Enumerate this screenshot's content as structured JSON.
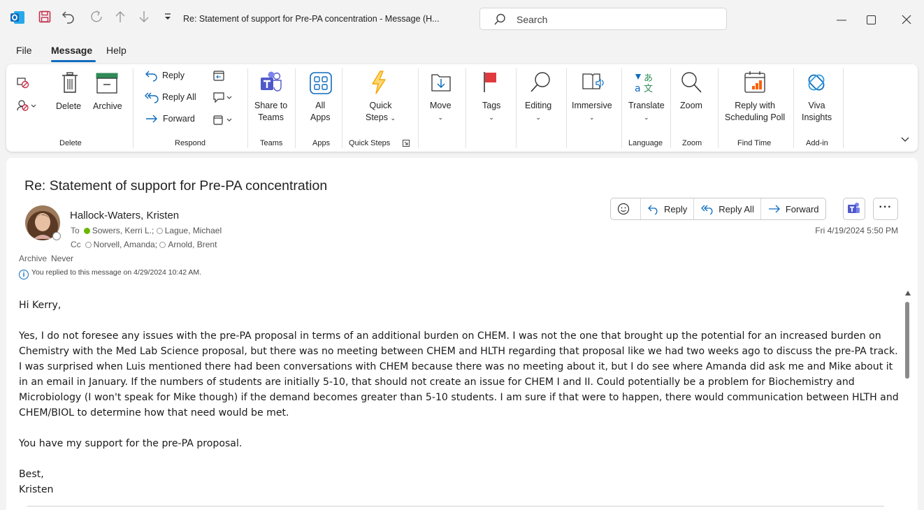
{
  "window": {
    "title": "Re: Statement of support for Pre-PA concentration  -  Message (H...",
    "search_placeholder": "Search"
  },
  "menu": {
    "items": [
      "File",
      "Message",
      "Help"
    ],
    "active": "Message"
  },
  "ribbon": {
    "groups": {
      "delete": "Delete",
      "respond": "Respond",
      "teams": "Teams",
      "apps": "Apps",
      "quick_steps": "Quick Steps",
      "language": "Language",
      "zoom": "Zoom",
      "find_time": "Find Time",
      "addin": "Add-in"
    },
    "buttons": {
      "delete": "Delete",
      "archive": "Archive",
      "reply": "Reply",
      "reply_all": "Reply All",
      "forward": "Forward",
      "share_to_teams_1": "Share to",
      "share_to_teams_2": "Teams",
      "all_apps_1": "All",
      "all_apps_2": "Apps",
      "quick_steps_1": "Quick",
      "quick_steps_2": "Steps",
      "move": "Move",
      "tags": "Tags",
      "editing": "Editing",
      "immersive": "Immersive",
      "translate": "Translate",
      "zoom": "Zoom",
      "reply_poll_1": "Reply with",
      "reply_poll_2": "Scheduling Poll",
      "viva_1": "Viva",
      "viva_2": "Insights"
    },
    "colors": {
      "accent": "#0f6cbd",
      "flag": "#e03a3e",
      "quick_steps": "#f7a600",
      "teams": "#5059c9"
    }
  },
  "message": {
    "subject": "Re: Statement of support for Pre-PA concentration",
    "sender": "Hallock-Waters, Kristen",
    "to_label": "To",
    "to": [
      "Sowers, Kerri L.;",
      "Lague, Michael"
    ],
    "cc_label": "Cc",
    "cc": [
      "Norvell, Amanda;",
      "Arnold, Brent"
    ],
    "archive_label": "Archive",
    "archive_value": "Never",
    "replied_notice": "You replied to this message on 4/29/2024 10:42 AM.",
    "date": "Fri 4/19/2024 5:50 PM",
    "actions": {
      "reply": "Reply",
      "reply_all": "Reply All",
      "forward": "Forward"
    },
    "body": {
      "greeting": "Hi Kerry,",
      "paragraph": "Yes, I do not foresee any issues with the pre-PA proposal in terms of an additional burden on CHEM.  I was not the one that brought up the potential for an increased burden on Chemistry with the Med Lab Science proposal, but there was no meeting between CHEM and HLTH regarding that proposal like we had two weeks ago to discuss the pre-PA track.  I was surprised when Luis mentioned there had been conversations with CHEM because there was no meeting about it, but I do see where Amanda did ask me and Mike about it in an email in January.  If the numbers of students are initially 5-10, that should not create an issue for CHEM I and II.  Could potentially be a problem for Biochemistry and Microbiology (I won't speak for Mike though) if the demand becomes greater than 5-10 students.  I am sure if that were to happen, there would communication between HLTH and CHEM/BIOL to determine how that need would be met.",
      "support": "You have my support for the pre-PA proposal.",
      "signoff": "Best,",
      "signature": "Kristen"
    }
  }
}
